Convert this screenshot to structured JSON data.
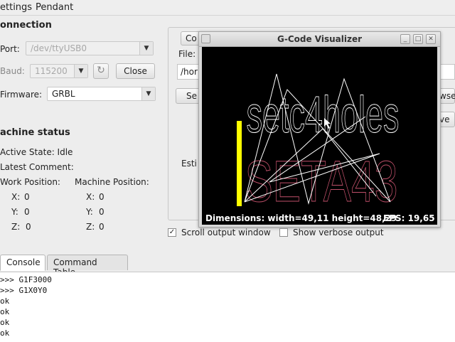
{
  "menu": {
    "settings": "ettings",
    "pendant": "Pendant"
  },
  "connection": {
    "header": "onnection",
    "port_label": "Port:",
    "port_value": "/dev/ttyUSB0",
    "baud_label": "Baud:",
    "baud_value": "115200",
    "refresh_icon": "↻",
    "close_button": "Close",
    "firmware_label": "Firmware:",
    "firmware_value": "GRBL"
  },
  "machine_status": {
    "header": "achine status",
    "active_state": "Active State:  Idle",
    "latest_comment": "Latest Comment:",
    "work_position_label": "Work Position:",
    "machine_position_label": "Machine Position:",
    "work": {
      "x_label": "X:",
      "x": "0",
      "y_label": "Y:",
      "y": "0",
      "z_label": "Z:",
      "z": "0"
    },
    "machine": {
      "x_label": "X:",
      "x": "0",
      "y_label": "Y:",
      "y": "0",
      "z_label": "Z:",
      "z": "0"
    }
  },
  "right_panel": {
    "tab_partial": "Co",
    "file_label": "File:",
    "path_partial": "/hor",
    "send_partial": "Se",
    "estimated_partial": "Esti",
    "browse_partial": "wse",
    "save_partial": "ve"
  },
  "visualizer": {
    "title": "G-Code Visualizer",
    "dimensions": "Dimensions: width=49,11 height=48,29",
    "fps": "FPS: 19,65",
    "top_text": "setc4holes",
    "bottom_text": "SETA43",
    "top_text_color": "#ffffff",
    "bottom_text_color": "#c0506a",
    "tool_color": "#ffff00"
  },
  "options": {
    "scroll_output": "Scroll output window",
    "scroll_checked": "✓",
    "verbose_output": "Show verbose output"
  },
  "tabs": {
    "console": "Console",
    "command_table": "Command Table"
  },
  "console_lines": [
    ">>> G1F3000",
    ">>> G1X0Y0",
    "ok",
    "ok",
    "ok",
    "ok"
  ]
}
